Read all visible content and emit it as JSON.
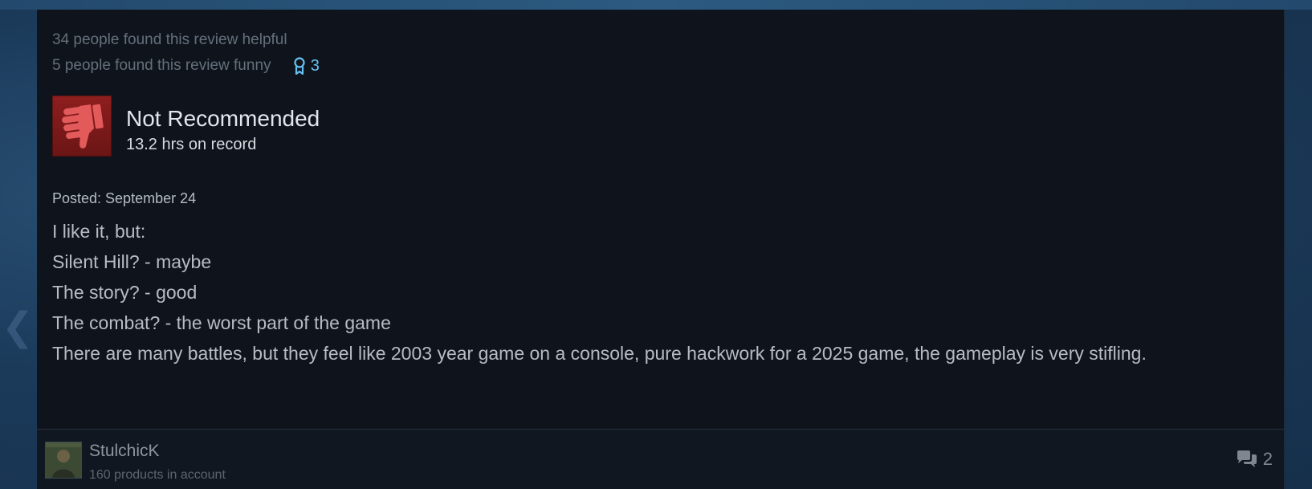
{
  "votes": {
    "helpful": "34 people found this review helpful",
    "funny": "5 people found this review funny",
    "award_icon": "award-ribbon-icon",
    "award_count": "3"
  },
  "recommendation": {
    "icon": "thumbs-down-icon",
    "title": "Not Recommended",
    "hours": "13.2 hrs on record"
  },
  "review": {
    "posted": "Posted: September 24",
    "lines": [
      "I like it, but:",
      "Silent Hill? - maybe",
      "The story? - good",
      "The combat? - the worst part of the game",
      "There are many battles, but they feel like 2003 year game on a console, pure hackwork for a 2025 game, the gameplay is very stifling."
    ]
  },
  "author": {
    "name": "StulchicK",
    "products": "160 products in account"
  },
  "comments": {
    "icon": "comments-icon",
    "count": "2"
  },
  "colors": {
    "card_bg": "#0f141c",
    "thumb_red": "#8e1e1e",
    "award_blue": "#66c0f4",
    "text_muted": "#646f7b",
    "text_body": "#b7bcc2"
  }
}
